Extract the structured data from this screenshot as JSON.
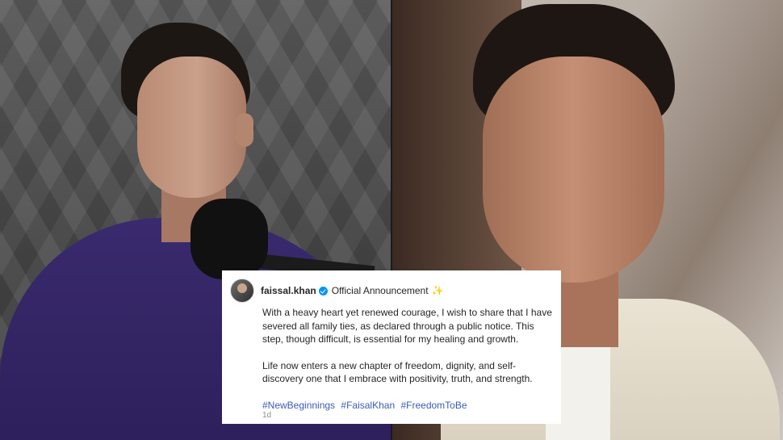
{
  "post": {
    "username": "faissal.khan",
    "headline": "Official Announcement",
    "paragraphs": [
      "With a heavy heart yet renewed courage, I wish to share that I have severed all family ties, as declared through a public notice. This step, though difficult, is essential for my healing and growth.",
      "Life now enters a new chapter of freedom, dignity, and self-discovery one that I embrace with positivity, truth, and strength."
    ],
    "hashtags": [
      "#NewBeginnings",
      "#FaisalKhan",
      "#FreedomToBe"
    ],
    "time": "1d"
  },
  "icons": {
    "avatar": "profile-avatar",
    "verified": "verified-badge-icon",
    "sparkle": "sparkle-icon"
  },
  "colors": {
    "verified_blue": "#0095f6",
    "hashtag_blue": "#3b5bb8",
    "shirt_purple": "#2d1f5b"
  }
}
